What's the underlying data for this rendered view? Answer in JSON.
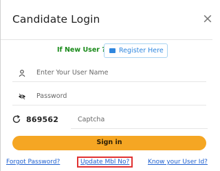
{
  "dialog": {
    "title": "Candidate Login",
    "close_symbol": "×"
  },
  "new_user": {
    "label": "If New User ?",
    "register_button": "Register Here"
  },
  "fields": {
    "username_placeholder": "Enter Your User Name",
    "password_placeholder": "Password",
    "captcha_code": "869562",
    "captcha_placeholder": "Captcha"
  },
  "signin_button": "Sign in",
  "links": {
    "forgot_password": "Forgot Password?",
    "update_mobile": "Update Mbl No?",
    "know_user_id": "Know your User Id?"
  },
  "colors": {
    "accent": "#f5a623",
    "link": "#1d5fd0",
    "highlight_border": "#e03131",
    "new_user_label": "#1a8a1a"
  }
}
